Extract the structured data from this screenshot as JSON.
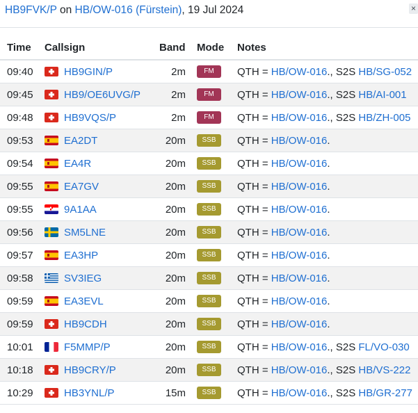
{
  "header": {
    "activator_call": "HB9FVK/P",
    "on_text": " on ",
    "summit": "HB/OW-016 (Fürstein)",
    "date_text": ", 19 Jul 2024",
    "close_symbol": "×"
  },
  "table": {
    "columns": {
      "time": "Time",
      "callsign": "Callsign",
      "band": "Band",
      "mode": "Mode",
      "notes": "Notes"
    },
    "mode_colors": {
      "FM": "#a23556",
      "SSB": "#a59a30"
    },
    "rows": [
      {
        "time": "09:40",
        "flag": "ch-flag-icon",
        "callsign": "HB9GIN/P",
        "band": "2m",
        "mode": "FM",
        "qth_label": "QTH = ",
        "qth": "HB/OW-016",
        "dot": ".",
        "s2s_label": ", S2S ",
        "s2s": "HB/SG-052"
      },
      {
        "time": "09:45",
        "flag": "ch-flag-icon",
        "callsign": "HB9/OE6UVG/P",
        "band": "2m",
        "mode": "FM",
        "qth_label": "QTH = ",
        "qth": "HB/OW-016",
        "dot": ".",
        "s2s_label": ", S2S ",
        "s2s": "HB/AI-001"
      },
      {
        "time": "09:48",
        "flag": "ch-flag-icon",
        "callsign": "HB9VQS/P",
        "band": "2m",
        "mode": "FM",
        "qth_label": "QTH = ",
        "qth": "HB/OW-016",
        "dot": ".",
        "s2s_label": ", S2S ",
        "s2s": "HB/ZH-005"
      },
      {
        "time": "09:53",
        "flag": "es-flag-icon",
        "callsign": "EA2DT",
        "band": "20m",
        "mode": "SSB",
        "qth_label": "QTH = ",
        "qth": "HB/OW-016",
        "dot": ".",
        "s2s_label": "",
        "s2s": ""
      },
      {
        "time": "09:54",
        "flag": "es-flag-icon",
        "callsign": "EA4R",
        "band": "20m",
        "mode": "SSB",
        "qth_label": "QTH = ",
        "qth": "HB/OW-016",
        "dot": ".",
        "s2s_label": "",
        "s2s": ""
      },
      {
        "time": "09:55",
        "flag": "es-flag-icon",
        "callsign": "EA7GV",
        "band": "20m",
        "mode": "SSB",
        "qth_label": "QTH = ",
        "qth": "HB/OW-016",
        "dot": ".",
        "s2s_label": "",
        "s2s": ""
      },
      {
        "time": "09:55",
        "flag": "hr-flag-icon",
        "callsign": "9A1AA",
        "band": "20m",
        "mode": "SSB",
        "qth_label": "QTH = ",
        "qth": "HB/OW-016",
        "dot": ".",
        "s2s_label": "",
        "s2s": ""
      },
      {
        "time": "09:56",
        "flag": "se-flag-icon",
        "callsign": "SM5LNE",
        "band": "20m",
        "mode": "SSB",
        "qth_label": "QTH = ",
        "qth": "HB/OW-016",
        "dot": ".",
        "s2s_label": "",
        "s2s": ""
      },
      {
        "time": "09:57",
        "flag": "es-flag-icon",
        "callsign": "EA3HP",
        "band": "20m",
        "mode": "SSB",
        "qth_label": "QTH = ",
        "qth": "HB/OW-016",
        "dot": ".",
        "s2s_label": "",
        "s2s": ""
      },
      {
        "time": "09:58",
        "flag": "gr-flag-icon",
        "callsign": "SV3IEG",
        "band": "20m",
        "mode": "SSB",
        "qth_label": "QTH = ",
        "qth": "HB/OW-016",
        "dot": ".",
        "s2s_label": "",
        "s2s": ""
      },
      {
        "time": "09:59",
        "flag": "es-flag-icon",
        "callsign": "EA3EVL",
        "band": "20m",
        "mode": "SSB",
        "qth_label": "QTH = ",
        "qth": "HB/OW-016",
        "dot": ".",
        "s2s_label": "",
        "s2s": ""
      },
      {
        "time": "09:59",
        "flag": "ch-flag-icon",
        "callsign": "HB9CDH",
        "band": "20m",
        "mode": "SSB",
        "qth_label": "QTH = ",
        "qth": "HB/OW-016",
        "dot": ".",
        "s2s_label": "",
        "s2s": ""
      },
      {
        "time": "10:01",
        "flag": "fr-flag-icon",
        "callsign": "F5MMP/P",
        "band": "20m",
        "mode": "SSB",
        "qth_label": "QTH = ",
        "qth": "HB/OW-016",
        "dot": ".",
        "s2s_label": ", S2S ",
        "s2s": "FL/VO-030"
      },
      {
        "time": "10:18",
        "flag": "ch-flag-icon",
        "callsign": "HB9CRY/P",
        "band": "20m",
        "mode": "SSB",
        "qth_label": "QTH = ",
        "qth": "HB/OW-016",
        "dot": ".",
        "s2s_label": ", S2S ",
        "s2s": "HB/VS-222"
      },
      {
        "time": "10:29",
        "flag": "ch-flag-icon",
        "callsign": "HB3YNL/P",
        "band": "15m",
        "mode": "SSB",
        "qth_label": "QTH = ",
        "qth": "HB/OW-016",
        "dot": ".",
        "s2s_label": ", S2S ",
        "s2s": "HB/GR-277"
      }
    ]
  }
}
